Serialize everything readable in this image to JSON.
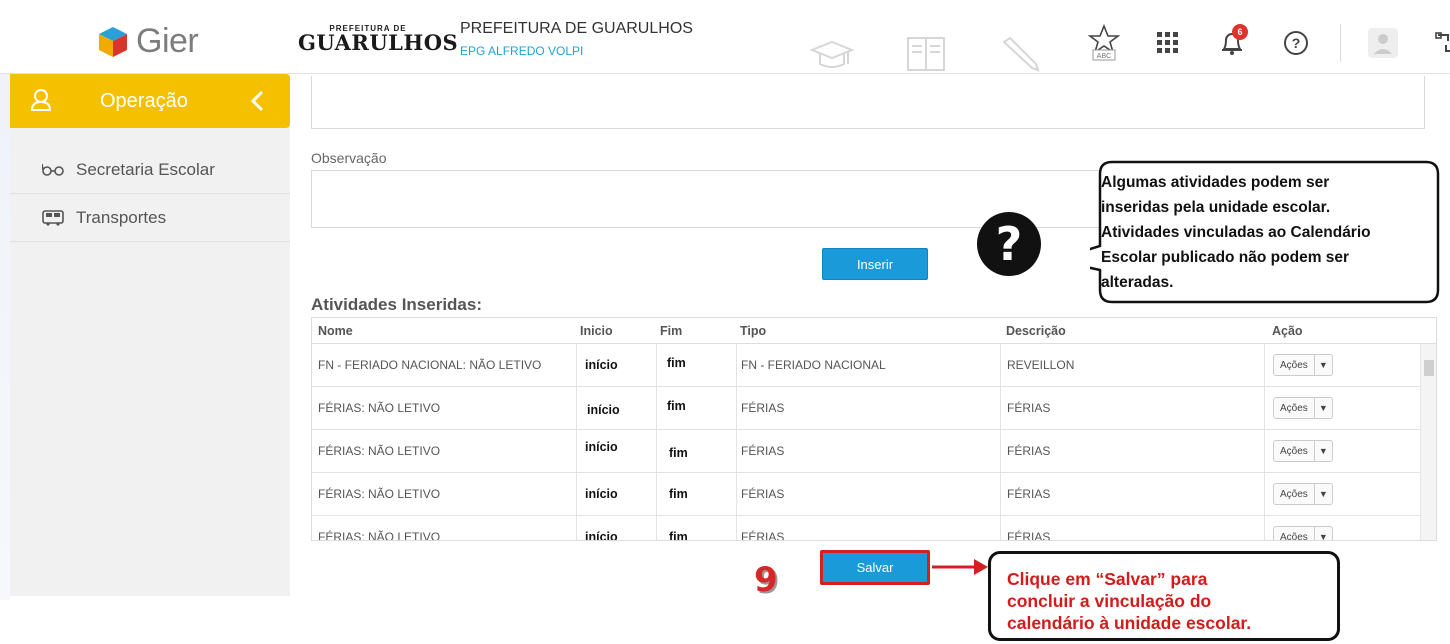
{
  "header": {
    "app_name": "Gier",
    "pref_logo_small": "PREFEITURA DE",
    "pref_logo_big": "GUARULHOS",
    "title": "PREFEITURA DE GUARULHOS",
    "school": "EPG ALFREDO VOLPI",
    "notifications_count": "6",
    "icons": [
      "graduation-cap-icon",
      "book-icon",
      "pencil-icon",
      "abc-star-icon",
      "apps-grid-icon",
      "bell-icon",
      "help-icon",
      "user-avatar-icon",
      "switch-icon"
    ]
  },
  "sidebar": {
    "active_label": "Operação",
    "items": [
      {
        "label": "Secretaria Escolar",
        "icon": "glasses-icon"
      },
      {
        "label": "Transportes",
        "icon": "bus-icon"
      }
    ]
  },
  "form": {
    "observacao_label": "Observação",
    "inserir_label": "Inserir"
  },
  "table": {
    "title": "Atividades Inseridas:",
    "headers": {
      "nome": "Nome",
      "inicio": "Inicio",
      "fim": "Fim",
      "tipo": "Tipo",
      "descricao": "Descrição",
      "acao": "Ação"
    },
    "rows": [
      {
        "nome": "FN - FERIADO NACIONAL: NÃO LETIVO",
        "inicio": "início",
        "fim": "fim",
        "tipo": "FN - FERIADO NACIONAL",
        "descricao": "REVEILLON",
        "acao": "Ações"
      },
      {
        "nome": "FÉRIAS: NÃO LETIVO",
        "inicio": "início",
        "fim": "fim",
        "tipo": "FÉRIAS",
        "descricao": "FÉRIAS",
        "acao": "Ações"
      },
      {
        "nome": "FÉRIAS: NÃO LETIVO",
        "inicio": "início",
        "fim": "fim",
        "tipo": "FÉRIAS",
        "descricao": "FÉRIAS",
        "acao": "Ações"
      },
      {
        "nome": "FÉRIAS: NÃO LETIVO",
        "inicio": "início",
        "fim": "fim",
        "tipo": "FÉRIAS",
        "descricao": "FÉRIAS",
        "acao": "Ações"
      },
      {
        "nome": "FÉRIAS: NÃO LETIVO",
        "inicio": "início",
        "fim": "fim",
        "tipo": "FÉRIAS",
        "descricao": "FÉRIAS",
        "acao": "Ações"
      }
    ]
  },
  "salvar_label": "Salvar",
  "step_number": "9",
  "callouts": {
    "top": [
      "Algumas atividades podem ser",
      "inseridas pela unidade escolar.",
      "Atividades vinculadas ao Calendário",
      "Escolar publicado não podem ser",
      "alteradas."
    ],
    "bottom": [
      "Clique em “Salvar” para",
      "concluir a vinculação do",
      "calendário à unidade escolar."
    ]
  },
  "colors": {
    "sidebar_active": "#f5c000",
    "button_blue": "#1a9ad9",
    "annotation_red": "#d42020"
  }
}
